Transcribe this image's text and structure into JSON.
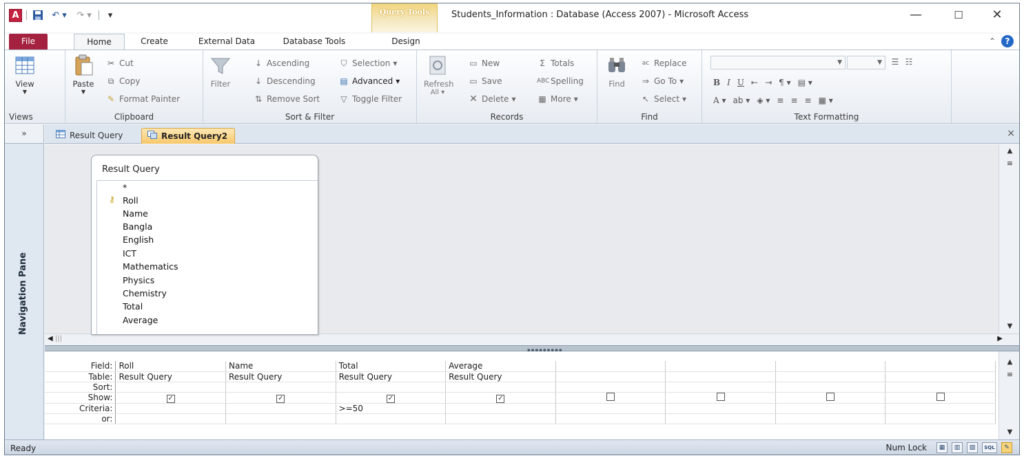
{
  "window": {
    "title": "Students_Information : Database (Access 2007) - Microsoft Access",
    "context_tab": "Query Tools",
    "controls": {
      "minimize": "—",
      "maximize": "☐",
      "close": "✕"
    }
  },
  "qat": {
    "app_icon": "A",
    "save": "💾",
    "undo": "↶ ▾",
    "redo": "↷ ▾",
    "customize": "▾"
  },
  "tabs": [
    {
      "label": "File"
    },
    {
      "label": "Home"
    },
    {
      "label": "Create"
    },
    {
      "label": "External Data"
    },
    {
      "label": "Database Tools"
    },
    {
      "label": "Design"
    }
  ],
  "ribbon": {
    "views": {
      "button": "View",
      "group": "Views"
    },
    "clipboard": {
      "paste": "Paste",
      "cut": "Cut",
      "copy": "Copy",
      "format_painter": "Format Painter",
      "group": "Clipboard"
    },
    "sort_filter": {
      "filter": "Filter",
      "ascending": "Ascending",
      "descending": "Descending",
      "remove_sort": "Remove Sort",
      "selection": "Selection",
      "advanced": "Advanced",
      "toggle_filter": "Toggle Filter",
      "group": "Sort & Filter"
    },
    "records": {
      "refresh": "Refresh",
      "refresh_sub": "All",
      "new": "New",
      "save": "Save",
      "delete": "Delete",
      "totals": "Totals",
      "spelling": "Spelling",
      "more": "More",
      "group": "Records"
    },
    "find": {
      "find": "Find",
      "replace": "Replace",
      "goto": "Go To",
      "select": "Select",
      "group": "Find"
    },
    "text_formatting": {
      "group": "Text Formatting",
      "bold": "B",
      "italic": "I",
      "underline": "U"
    }
  },
  "nav_pane": {
    "toggle": "»",
    "label": "Navigation Pane"
  },
  "doc_tabs": [
    {
      "label": "Result Query"
    },
    {
      "label": "Result Query2"
    }
  ],
  "doc_close": "×",
  "field_list": {
    "title": "Result Query",
    "fields": [
      "*",
      "Roll",
      "Name",
      "Bangla",
      "English",
      "ICT",
      "Mathematics",
      "Physics",
      "Chemistry",
      "Total",
      "Average"
    ]
  },
  "design_grid": {
    "row_labels": [
      "Field:",
      "Table:",
      "Sort:",
      "Show:",
      "Criteria:",
      "or:"
    ],
    "columns": [
      {
        "field": "Roll",
        "table": "Result Query",
        "sort": "",
        "show": true,
        "criteria": "",
        "or": ""
      },
      {
        "field": "Name",
        "table": "Result Query",
        "sort": "",
        "show": true,
        "criteria": "",
        "or": ""
      },
      {
        "field": "Total",
        "table": "Result Query",
        "sort": "",
        "show": true,
        "criteria": ">=50",
        "or": ""
      },
      {
        "field": "Average",
        "table": "Result Query",
        "sort": "",
        "show": true,
        "criteria": "",
        "or": ""
      },
      {
        "field": "",
        "table": "",
        "sort": "",
        "show": false,
        "criteria": "",
        "or": ""
      },
      {
        "field": "",
        "table": "",
        "sort": "",
        "show": false,
        "criteria": "",
        "or": ""
      },
      {
        "field": "",
        "table": "",
        "sort": "",
        "show": false,
        "criteria": "",
        "or": ""
      },
      {
        "field": "",
        "table": "",
        "sort": "",
        "show": false,
        "criteria": "",
        "or": ""
      }
    ]
  },
  "status": {
    "left": "Ready",
    "num_lock": "Num Lock",
    "sql": "SQL"
  },
  "colors": {
    "file_tab": "#a4223f",
    "context_tab": "#f1d57e",
    "active_doc_tab": "#f7c86b"
  }
}
